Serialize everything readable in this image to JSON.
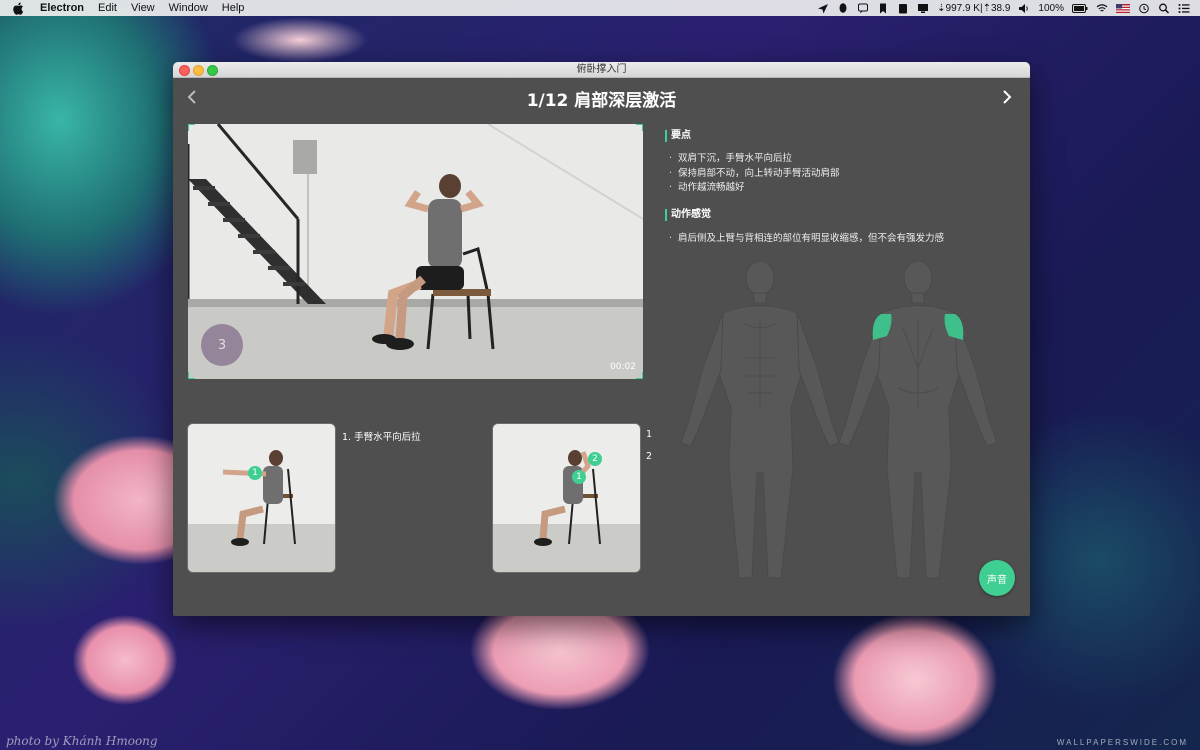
{
  "menubar": {
    "app_name": "Electron",
    "items": [
      "Edit",
      "View",
      "Window",
      "Help"
    ],
    "network": "⇣997.9 K|⇡38.9",
    "battery": "100%"
  },
  "window": {
    "title": "俯卧撑入门",
    "heading": "1/12 肩部深层激活"
  },
  "video": {
    "countdown": "3",
    "timestamp": "00:02"
  },
  "key_points": {
    "title": "要点",
    "items": [
      "双肩下沉，手臂水平向后拉",
      "保持肩部不动，向上转动手臂活动肩部",
      "动作越流畅越好"
    ]
  },
  "feeling": {
    "title": "动作感觉",
    "items": [
      "肩后侧及上臂与背相连的部位有明显收缩感，但不会有强发力感"
    ]
  },
  "steps": [
    {
      "label": "1. 手臂水平向后拉",
      "badges": [
        "1"
      ]
    },
    {
      "label": "1",
      "label2": "2",
      "badges": [
        "1",
        "2"
      ]
    }
  ],
  "sound_button": "声音",
  "wallpaper": {
    "signature": "photo by Khánh Hmoong",
    "site": "WALLPAPERSWIDE.COM"
  },
  "colors": {
    "accent": "#3fcf93",
    "window_bg": "#4f4f4f",
    "muscle_highlight": "#3fbf8a"
  }
}
